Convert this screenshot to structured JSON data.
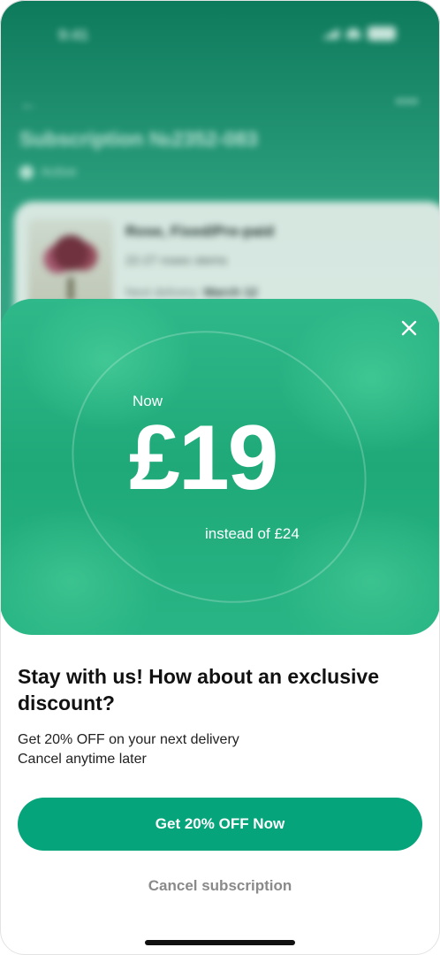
{
  "status_bar": {
    "time": "9:41"
  },
  "background_screen": {
    "title": "Subscription №2352-083",
    "status": "Active",
    "card": {
      "name": "Rose, Fixed/Pre-paid",
      "subtitle": "22-27 roses stems",
      "next_delivery_label": "Next delivery:",
      "next_delivery_value": "March 12"
    }
  },
  "promo": {
    "now_label": "Now",
    "price": "£19",
    "instead_label": "instead of £24"
  },
  "offer": {
    "heading": "Stay with us! How about an exclusive discount?",
    "line1": "Get 20% OFF on your next delivery",
    "line2": "Cancel anytime later"
  },
  "actions": {
    "primary_label": "Get 20% OFF Now",
    "cancel_label": "Cancel subscription"
  },
  "colors": {
    "accent": "#05a47b",
    "promo_bg": "#1fa979"
  }
}
